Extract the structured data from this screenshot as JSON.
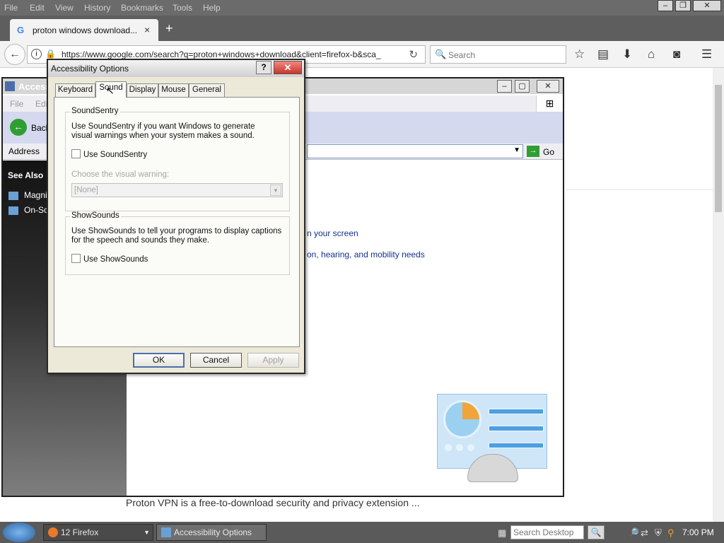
{
  "firefox": {
    "menu": [
      "File",
      "Edit",
      "View",
      "History",
      "Bookmarks",
      "Tools",
      "Help"
    ],
    "window_controls": [
      "–",
      "❐",
      "✕"
    ],
    "tab_title": "proton windows download...",
    "tab_close": "×",
    "new_tab": "+",
    "url": "https://www.google.com/search?q=proton+windows+download&client=firefox-b&sca_",
    "search_placeholder": "Search",
    "page_snippet": "Proton VPN is a free-to-download security and privacy extension ..."
  },
  "explorer": {
    "title": "Accessibility Options",
    "menu": [
      "File",
      "Edit"
    ],
    "back_label": "Back",
    "address_label": "Address",
    "go_label": "Go",
    "see_also": "See Also",
    "see_also_items": [
      "Magnifier",
      "On-Screen Keyboard"
    ],
    "links": [
      "n your screen",
      "on, hearing, and mobility needs"
    ]
  },
  "dialog": {
    "title": "Accessibility Options",
    "help": "?",
    "close": "✕",
    "tabs": [
      "Keyboard",
      "Sound",
      "Display",
      "Mouse",
      "General"
    ],
    "active_tab": "Sound",
    "soundsentry": {
      "group_title": "SoundSentry",
      "description": "Use SoundSentry if you want Windows to generate visual warnings when your system makes a sound.",
      "checkbox_label": "Use SoundSentry",
      "checked": false,
      "visual_label": "Choose the visual warning:",
      "visual_value": "[None]"
    },
    "showsounds": {
      "group_title": "ShowSounds",
      "description": "Use ShowSounds to tell your programs to display captions for the speech and sounds they make.",
      "checkbox_label": "Use ShowSounds",
      "checked": false
    },
    "buttons": {
      "ok": "OK",
      "cancel": "Cancel",
      "apply": "Apply"
    }
  },
  "taskbar": {
    "firefox_task": "12 Firefox",
    "accessibility_task": "Accessibility Options",
    "search_placeholder": "Search Desktop",
    "clock": "7:00 PM"
  },
  "colors": {
    "dialog_bg": "#ece9d8",
    "link": "#15318c",
    "go_green": "#2f9e33",
    "close_red": "#c8352a"
  }
}
